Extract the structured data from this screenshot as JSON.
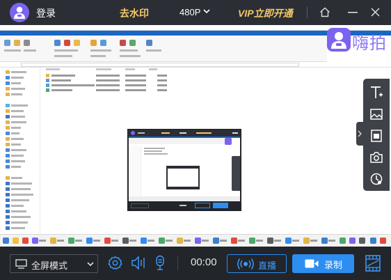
{
  "app": {
    "login_label": "登录",
    "watermark_label": "去水印",
    "resolution_label": "480P",
    "vip_label": "VIP立即开通",
    "brand_label": "嗨拍"
  },
  "icons": {
    "home": "home-icon",
    "minimize": "minimize-icon",
    "close": "close-icon",
    "text_tool": "text-icon",
    "image_tool": "image-icon",
    "portrait_tool": "portrait-icon",
    "camera_tool": "camera-icon",
    "timer_tool": "timer-icon",
    "settings": "gear-icon",
    "speaker": "speaker-icon",
    "microphone": "microphone-icon",
    "live": "broadcast-icon",
    "record": "video-camera-icon",
    "film": "film-icon"
  },
  "controls": {
    "mode_label": "全屏模式",
    "timer_text": "00:00",
    "live_label": "直播",
    "record_label": "录制"
  },
  "colors": {
    "accent_blue": "#2e8df0",
    "gold": "#f5c86a",
    "brand_purple": "#7b63f1",
    "bar_bg": "#22252a"
  }
}
